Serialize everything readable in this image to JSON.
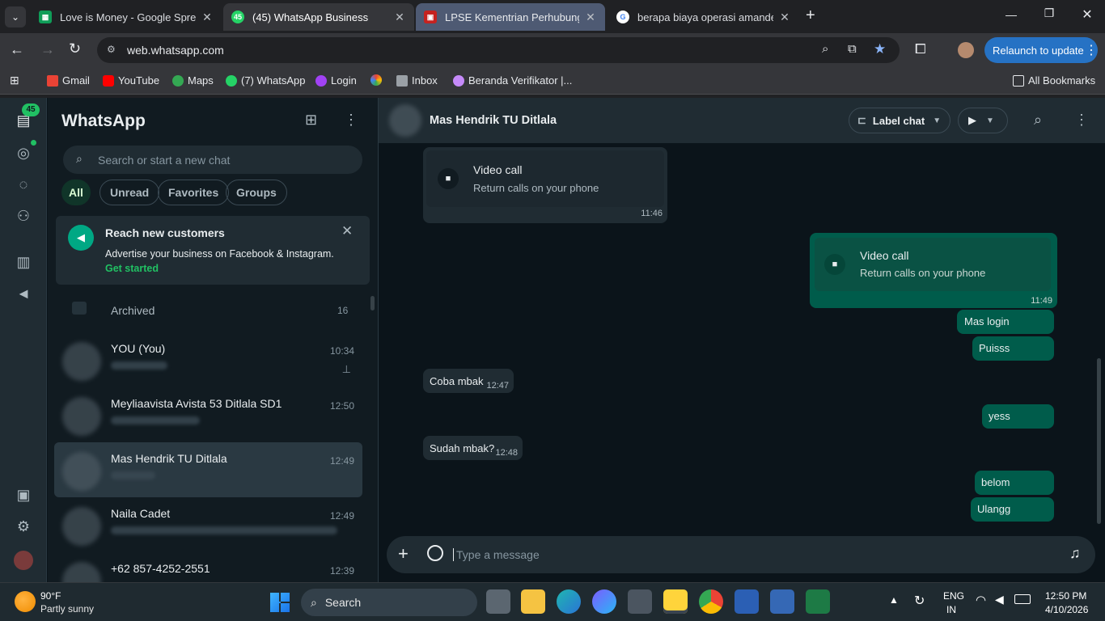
{
  "tabs": [
    {
      "title": "Love is Money - Google Spread",
      "color": "#0f9d58"
    },
    {
      "title": "(45) WhatsApp Business",
      "color": "#25d366",
      "badge": "45"
    },
    {
      "title": "LPSE Kementrian Perhubungan",
      "color": "#c5221f"
    },
    {
      "title": "berapa biaya operasi amandel",
      "color": "#4285f4"
    }
  ],
  "url": "web.whatsapp.com",
  "relaunch_label": "Relaunch to update",
  "bookmarks": [
    "Gmail",
    "YouTube",
    "Maps",
    "(7) WhatsApp",
    "Login",
    "",
    "Inbox",
    "Beranda Verifikator |..."
  ],
  "all_bookmarks": "All Bookmarks",
  "wa": {
    "badge": "45",
    "app_title": "WhatsApp",
    "search_placeholder": "Search or start a new chat",
    "filters": [
      "All",
      "Unread",
      "Favorites",
      "Groups"
    ],
    "promo": {
      "title": "Reach new customers",
      "body": "Advertise your business on Facebook & Instagram.",
      "cta": "Get started"
    },
    "archived": {
      "label": "Archived",
      "count": "16"
    },
    "chats": [
      {
        "name": "YOU (You)",
        "time": "10:34"
      },
      {
        "name": "Meyliaavista Avista 53 Ditlala SD1",
        "time": "12:50"
      },
      {
        "name": "Mas Hendrik TU Ditlala",
        "time": "12:49"
      },
      {
        "name": "Naila Cadet",
        "time": "12:49"
      },
      {
        "name": "+62 857-4252-2551",
        "time": "12:39"
      }
    ],
    "header": {
      "name": "Mas Hendrik TU Ditlala",
      "label_chat": "Label chat"
    },
    "messages": {
      "call_in": {
        "title": "Video call",
        "sub": "Return calls on your phone",
        "time": "11:46"
      },
      "call_out": {
        "title": "Video call",
        "sub": "Return calls on your phone",
        "time": "11:49"
      },
      "out1": "Mas login",
      "out2": "Puisss",
      "in1": {
        "text": "Coba mbak",
        "time": "12:47"
      },
      "out3": "yess",
      "in2": {
        "text": "Sudah mbak?",
        "time": "12:48"
      },
      "out4": "belom",
      "out5": "Ulangg"
    },
    "composer_placeholder": "Type a message"
  },
  "taskbar": {
    "temp": "90°F",
    "weather": "Partly sunny",
    "search": "Search",
    "lang1": "ENG",
    "lang2": "IN",
    "time": "12:50 PM",
    "date": "4/10/2026"
  }
}
